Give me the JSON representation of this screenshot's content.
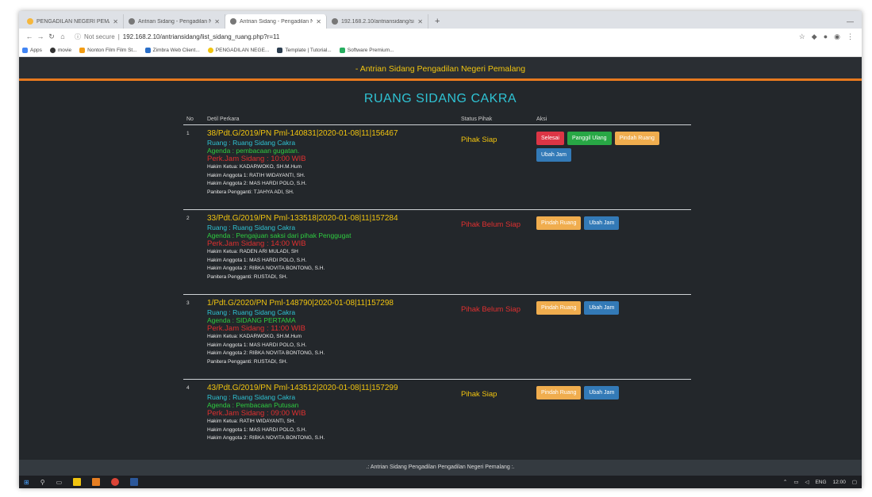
{
  "browser": {
    "tabs": [
      {
        "label": "PENGADILAN NEGERI PEMALA...",
        "active": false
      },
      {
        "label": "Antrian Sidang - Pengadilan Ne...",
        "active": false
      },
      {
        "label": "Antrian Sidang - Pengadilan Ne...",
        "active": true
      },
      {
        "label": "192.168.2.10/antriansidang/sidan...",
        "active": false
      }
    ],
    "security_label": "Not secure",
    "url": "192.168.2.10/antriansidang/list_sidang_ruang.php?r=11",
    "bookmarks": [
      {
        "label": "Apps",
        "color": "#4285f4"
      },
      {
        "label": "movie",
        "color": "#333333"
      },
      {
        "label": "Nonton Film Film St...",
        "color": "#f39c12"
      },
      {
        "label": "Zimbra Web Client...",
        "color": "#2a6fc9"
      },
      {
        "label": "PENGADILAN NEGE...",
        "color": "#f1c40f"
      },
      {
        "label": "Template | Tutorial...",
        "color": "#2c3e50"
      },
      {
        "label": "Software Premium...",
        "color": "#27ae60"
      }
    ]
  },
  "page": {
    "navbar_title": "- Antrian Sidang Pengadilan Negeri Pemalang",
    "heading": "RUANG SIDANG CAKRA",
    "table_headers": {
      "no": "No",
      "detail": "Detil Perkara",
      "status": "Status Pihak",
      "aksi": "Aksi"
    },
    "rows": [
      {
        "no": "1",
        "case": "38/Pdt.G/2019/PN Pml-140831|2020-01-08|11|156467",
        "ruang": "Ruang : Ruang Sidang Cakra",
        "agenda": "Agenda : pembacaan gugatan.",
        "jam": "Perk.Jam Sidang : 10:00 WIB",
        "ketua": "Hakim Ketua: KADARWOKO, SH.M.Hum",
        "anggota1": "Hakim Anggota 1: RATIH WIDAYANTI, SH.",
        "anggota2": "Hakim Anggota 2: MAS HARDI POLO, S.H.",
        "panitera": "Panitera Pengganti: TJAHYA ADI, SH.",
        "status": "Pihak Siap",
        "status_ok": true,
        "buttons": [
          "Selesai",
          "Panggil Ulang",
          "Pindah Ruang",
          "Ubah Jam"
        ]
      },
      {
        "no": "2",
        "case": "33/Pdt.G/2019/PN Pml-133518|2020-01-08|11|157284",
        "ruang": "Ruang : Ruang Sidang Cakra",
        "agenda": "Agenda : Pengajuan saksi dari pihak Penggugat",
        "jam": "Perk.Jam Sidang : 14:00 WIB",
        "ketua": "Hakim Ketua: RADEN ARI MULADI, SH",
        "anggota1": "Hakim Anggota 1: MAS HARDI POLO, S.H.",
        "anggota2": "Hakim Anggota 2: RIBKA NOVITA BONTONG, S.H.",
        "panitera": "Panitera Pengganti: RUSTADI, SH.",
        "status": "Pihak Belum Siap",
        "status_ok": false,
        "buttons": [
          "Pindah Ruang",
          "Ubah Jam"
        ]
      },
      {
        "no": "3",
        "case": "1/Pdt.G/2020/PN Pml-148790|2020-01-08|11|157298",
        "ruang": "Ruang : Ruang Sidang Cakra",
        "agenda": "Agenda : SIDANG PERTAMA",
        "jam": "Perk.Jam Sidang : 11:00 WIB",
        "ketua": "Hakim Ketua: KADARWOKO, SH.M.Hum",
        "anggota1": "Hakim Anggota 1: MAS HARDI POLO, S.H.",
        "anggota2": "Hakim Anggota 2: RIBKA NOVITA BONTONG, S.H.",
        "panitera": "Panitera Pengganti: RUSTADI, SH.",
        "status": "Pihak Belum Siap",
        "status_ok": false,
        "buttons": [
          "Pindah Ruang",
          "Ubah Jam"
        ]
      },
      {
        "no": "4",
        "case": "43/Pdt.G/2019/PN Pml-143512|2020-01-08|11|157299",
        "ruang": "Ruang : Ruang Sidang Cakra",
        "agenda": "Agenda : Pembacaan Putusan",
        "jam": "Perk.Jam Sidang : 09:00 WIB",
        "ketua": "Hakim Ketua: RATIH WIDAYANTI, SH.",
        "anggota1": "Hakim Anggota 1: MAS HARDI POLO, S.H.",
        "anggota2": "Hakim Anggota 2: RIBKA NOVITA BONTONG, S.H.",
        "panitera": "",
        "status": "Pihak Siap",
        "status_ok": true,
        "buttons": [
          "Pindah Ruang",
          "Ubah Jam"
        ]
      }
    ],
    "footer": ".: Antrian Sidang Pengadilan Pengadilan Negeri Pemalang :."
  },
  "taskbar": {
    "lang": "ENG",
    "time": "12:00"
  }
}
